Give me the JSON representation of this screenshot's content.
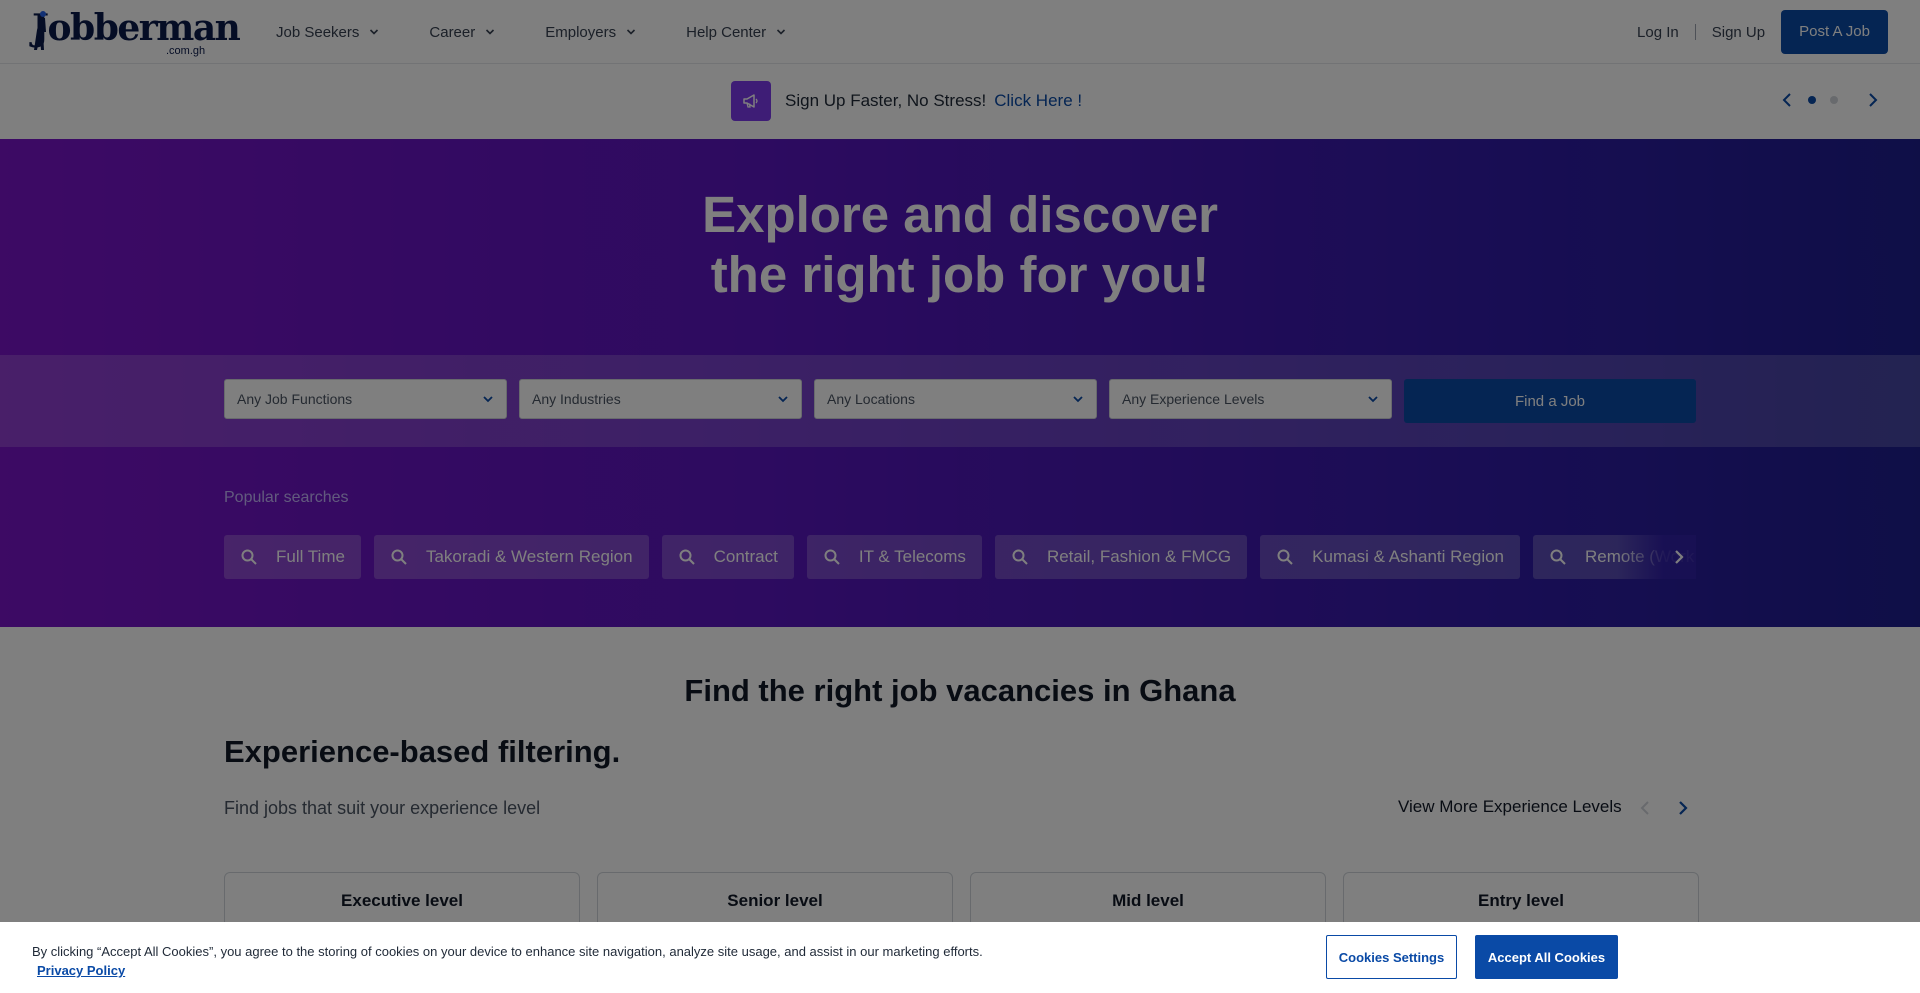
{
  "header": {
    "logo_text": "Jobberman",
    "logo_domain": ".com.gh",
    "nav": [
      {
        "label": "Job Seekers"
      },
      {
        "label": "Career"
      },
      {
        "label": "Employers"
      },
      {
        "label": "Help Center"
      }
    ],
    "login": "Log In",
    "signup": "Sign Up",
    "post_job": "Post A Job"
  },
  "promo": {
    "text": "Sign Up Faster, No Stress!",
    "link": "Click Here !",
    "icon": "megaphone-icon"
  },
  "hero": {
    "title_line1": "Explore and discover",
    "title_line2": "the right job for you!",
    "filters": [
      {
        "placeholder": "Any Job Functions"
      },
      {
        "placeholder": "Any Industries"
      },
      {
        "placeholder": "Any Locations"
      },
      {
        "placeholder": "Any Experience Levels"
      }
    ],
    "find_button": "Find a Job",
    "popular_label": "Popular searches",
    "popular": [
      "Full Time",
      "Takoradi & Western Region",
      "Contract",
      "IT & Telecoms",
      "Retail, Fashion & FMCG",
      "Kumasi & Ashanti Region",
      "Remote (Work From Home)"
    ]
  },
  "content": {
    "section_title": "Find the right job vacancies in Ghana",
    "exp_title": "Experience-based filtering.",
    "exp_sub": "Find jobs that suit your experience level",
    "view_more": "View More Experience Levels",
    "cards": [
      "Executive level",
      "Senior level",
      "Mid level",
      "Entry level"
    ]
  },
  "cookie": {
    "text": "By clicking “Accept All Cookies”, you agree to the storing of cookies on your device to enhance site navigation, analyze site usage, and assist in our marketing efforts.",
    "privacy": "Privacy Policy",
    "settings": "Cookies Settings",
    "accept": "Accept All Cookies"
  },
  "colors": {
    "brand_blue": "#0a4aa6",
    "hero_purple": "#7a14c9",
    "hero_indigo": "#1e1e8f"
  }
}
